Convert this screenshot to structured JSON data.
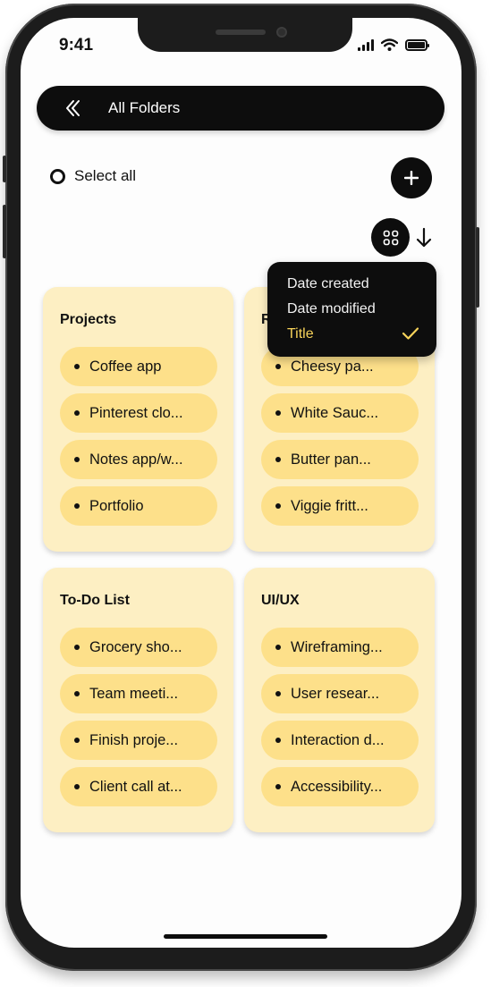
{
  "status_bar": {
    "time": "9:41"
  },
  "header": {
    "title": "All Folders"
  },
  "toolbar": {
    "select_all_label": "Select all"
  },
  "sort_menu": {
    "options": [
      "Date created",
      "Date modified",
      "Title"
    ],
    "selected": "Title"
  },
  "folders": [
    {
      "title": "Projects",
      "items": [
        "Coffee app",
        "Pinterest clo...",
        "Notes app/w...",
        "Portfolio"
      ]
    },
    {
      "title": "R",
      "items": [
        "Cheesy pa...",
        "White Sauc...",
        "Butter pan...",
        "Viggie fritt..."
      ]
    },
    {
      "title": "To-Do List",
      "items": [
        "Grocery sho...",
        "Team meeti...",
        "Finish proje...",
        "Client call at..."
      ]
    },
    {
      "title": "UI/UX",
      "items": [
        "Wireframing...",
        "User resear...",
        "Interaction d...",
        "Accessibility..."
      ]
    }
  ],
  "colors": {
    "card_bg": "#fdefc3",
    "chip_bg": "#fde08a",
    "accent_selected": "#f7d35a",
    "dark": "#0d0d0d"
  }
}
